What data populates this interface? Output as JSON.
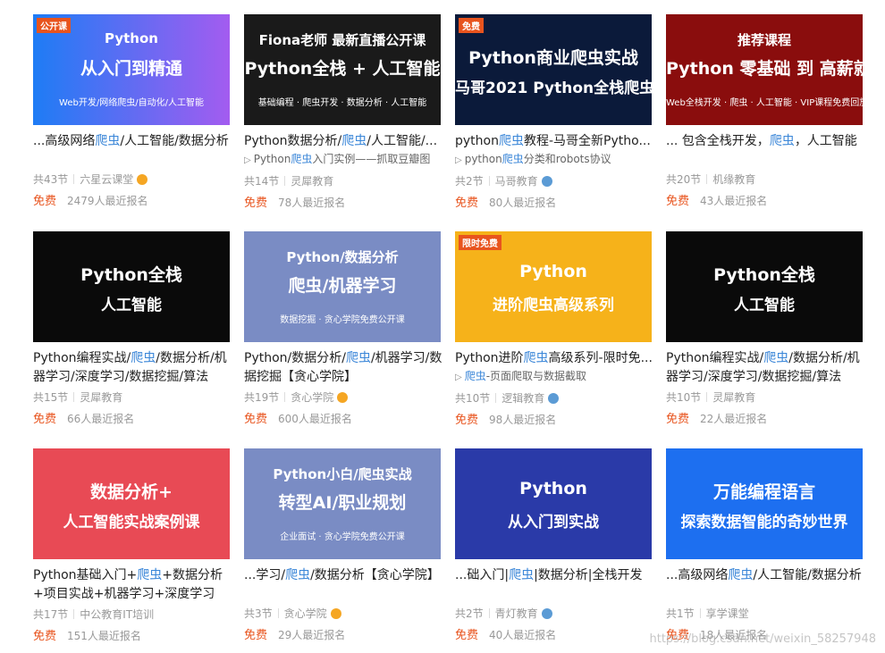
{
  "cards": [
    {
      "thumb": {
        "bg": "linear-gradient(90deg,#1e7cf5,#a35cf0)",
        "line1": "Python",
        "line2": "从入门到精通",
        "line3": "Web开发/网络爬虫/自动化/人工智能",
        "tag": "公开课"
      },
      "title_pre": "...高级网络",
      "title_hl": "爬虫",
      "title_post": "/人工智能/数据分析",
      "sub_pre": "",
      "sub_hl": "",
      "sub_post": "",
      "lessons": "共43节",
      "org": "六星云课堂",
      "badge": "gold",
      "price": "免费",
      "enrolled": "2479人最近报名"
    },
    {
      "thumb": {
        "bg": "#1a1a1a",
        "line1": "Fiona老师 最新直播公开课",
        "line2": "Python全栈 + 人工智能",
        "line3": "基础编程 · 爬虫开发 · 数据分析 · 人工智能",
        "tag": ""
      },
      "title_pre": "Python数据分析/",
      "title_hl": "爬虫",
      "title_post": "/人工智能/...",
      "sub_pre": "Python",
      "sub_hl": "爬虫",
      "sub_post": "入门实例——抓取豆瓣图",
      "lessons": "共14节",
      "org": "灵犀教育",
      "badge": "",
      "price": "免费",
      "enrolled": "78人最近报名"
    },
    {
      "thumb": {
        "bg": "#0b1a3a",
        "line1": "",
        "line2": "Python商业爬虫实战",
        "line3": "马哥2021 Python全栈爬虫",
        "tag": "免费"
      },
      "title_pre": "python",
      "title_hl": "爬虫",
      "title_post": "教程-马哥全新Pytho...",
      "sub_pre": "python",
      "sub_hl": "爬虫",
      "sub_post": "分类和robots协议",
      "lessons": "共2节",
      "org": "马哥教育",
      "badge": "blue",
      "price": "免费",
      "enrolled": "80人最近报名"
    },
    {
      "thumb": {
        "bg": "#8a0d0d",
        "line1": "推荐课程",
        "line2": "Python 零基础 到 高薪就业",
        "line3": "Web全栈开发 · 爬虫 · 人工智能 · VIP课程免费回放+直播课程",
        "tag": ""
      },
      "title_pre": "... 包含全栈开发，",
      "title_hl": "爬虫",
      "title_post": "，人工智能",
      "sub_pre": "",
      "sub_hl": "",
      "sub_post": "",
      "lessons": "共20节",
      "org": "机缘教育",
      "badge": "",
      "price": "免费",
      "enrolled": "43人最近报名"
    },
    {
      "thumb": {
        "bg": "#0a0a0a",
        "line1": "",
        "line2": "Python全栈",
        "line3": "人工智能",
        "tag": ""
      },
      "title_pre": "Python编程实战/",
      "title_hl": "爬虫",
      "title_post": "/数据分析/机器学习/深度学习/数据挖掘/算法",
      "sub_pre": "",
      "sub_hl": "",
      "sub_post": "",
      "lessons": "共15节",
      "org": "灵犀教育",
      "badge": "",
      "price": "免费",
      "enrolled": "66人最近报名"
    },
    {
      "thumb": {
        "bg": "#7a8cc4",
        "line1": "Python/数据分析",
        "line2": "爬虫/机器学习",
        "line3": "数据挖掘 · 贪心学院免费公开课",
        "tag": ""
      },
      "title_pre": "Python/数据分析/",
      "title_hl": "爬虫",
      "title_post": "/机器学习/数据挖掘【贪心学院】",
      "sub_pre": "",
      "sub_hl": "",
      "sub_post": "",
      "lessons": "共19节",
      "org": "贪心学院",
      "badge": "gold",
      "price": "免费",
      "enrolled": "600人最近报名"
    },
    {
      "thumb": {
        "bg": "#f6b21a",
        "line1": "",
        "line2": "Python",
        "line3": "进阶爬虫高级系列",
        "tag": "限时免费"
      },
      "title_pre": "Python进阶",
      "title_hl": "爬虫",
      "title_post": "高级系列-限时免...",
      "sub_pre": "",
      "sub_hl": "爬虫",
      "sub_post": "-页面爬取与数据截取",
      "lessons": "共10节",
      "org": "逻辑教育",
      "badge": "blue",
      "price": "免费",
      "enrolled": "98人最近报名"
    },
    {
      "thumb": {
        "bg": "#0a0a0a",
        "line1": "",
        "line2": "Python全栈",
        "line3": "人工智能",
        "tag": ""
      },
      "title_pre": "Python编程实战/",
      "title_hl": "爬虫",
      "title_post": "/数据分析/机器学习/深度学习/数据挖掘/算法",
      "sub_pre": "",
      "sub_hl": "",
      "sub_post": "",
      "lessons": "共10节",
      "org": "灵犀教育",
      "badge": "",
      "price": "免费",
      "enrolled": "22人最近报名"
    },
    {
      "thumb": {
        "bg": "#e84a55",
        "line1": "",
        "line2": "数据分析+",
        "line3": "人工智能实战案例课",
        "tag": ""
      },
      "title_pre": "Python基础入门+",
      "title_hl": "爬虫",
      "title_post": "+数据分析+项目实战+机器学习+深度学习",
      "sub_pre": "",
      "sub_hl": "",
      "sub_post": "",
      "lessons": "共17节",
      "org": "中公教育IT培训",
      "badge": "",
      "price": "免费",
      "enrolled": "151人最近报名"
    },
    {
      "thumb": {
        "bg": "#7a8cc4",
        "line1": "Python小白/爬虫实战",
        "line2": "转型AI/职业规划",
        "line3": "企业面试 · 贪心学院免费公开课",
        "tag": ""
      },
      "title_pre": "...学习/",
      "title_hl": "爬虫",
      "title_post": "/数据分析【贪心学院】",
      "sub_pre": "",
      "sub_hl": "",
      "sub_post": "",
      "lessons": "共3节",
      "org": "贪心学院",
      "badge": "gold",
      "price": "免费",
      "enrolled": "29人最近报名"
    },
    {
      "thumb": {
        "bg": "#2a3aa8",
        "line1": "",
        "line2": "Python",
        "line3": "从入门到实战",
        "tag": ""
      },
      "title_pre": "...础入门|",
      "title_hl": "爬虫",
      "title_post": "|数据分析|全栈开发",
      "sub_pre": "",
      "sub_hl": "",
      "sub_post": "",
      "lessons": "共2节",
      "org": "青灯教育",
      "badge": "blue",
      "price": "免费",
      "enrolled": "40人最近报名"
    },
    {
      "thumb": {
        "bg": "#1d6ff0",
        "line1": "",
        "line2": "万能编程语言",
        "line3": "探索数据智能的奇妙世界",
        "tag": ""
      },
      "title_pre": "...高级网络",
      "title_hl": "爬虫",
      "title_post": "/人工智能/数据分析",
      "sub_pre": "",
      "sub_hl": "",
      "sub_post": "",
      "lessons": "共1节",
      "org": "享学课堂",
      "badge": "",
      "price": "免费",
      "enrolled": "18人最近报名"
    }
  ],
  "watermark": "https://blog.csdn.net/weixin_58257948"
}
